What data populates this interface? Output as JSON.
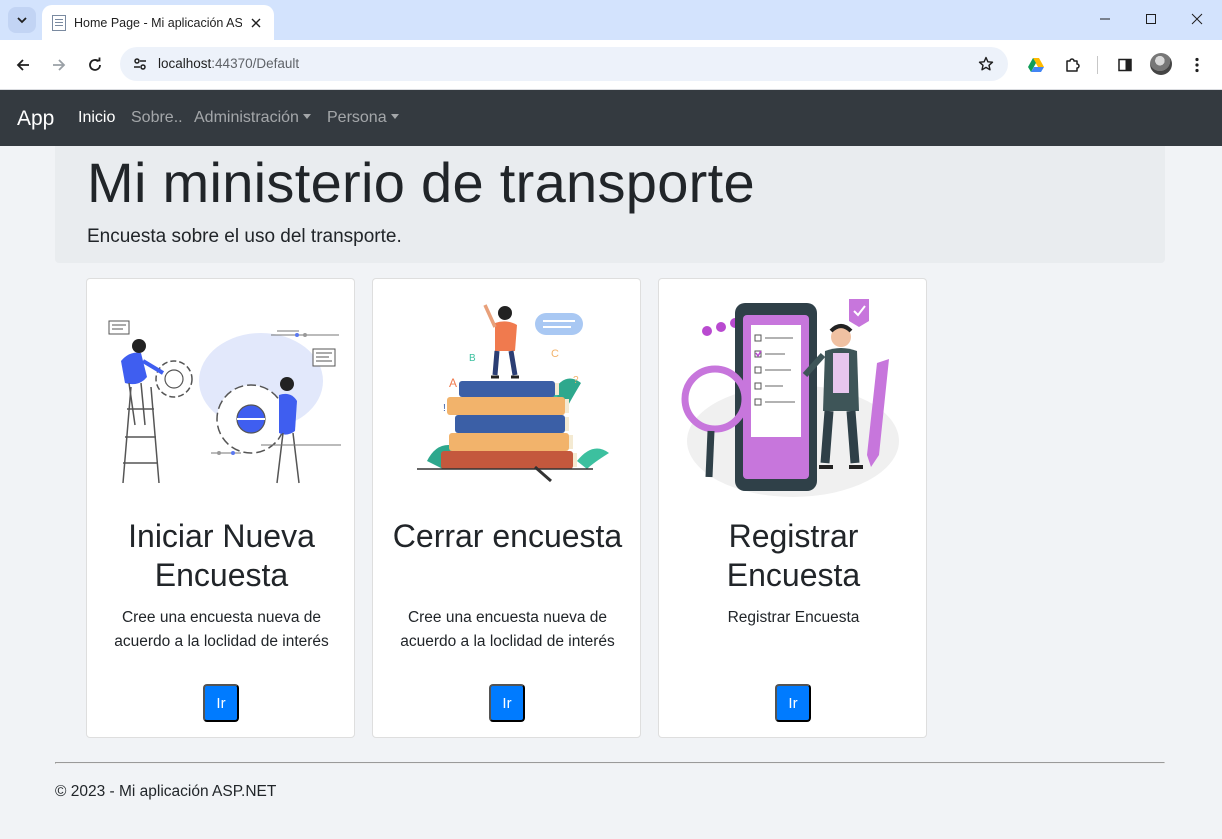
{
  "browser": {
    "tab_title": "Home Page - Mi aplicación ASP.NET",
    "url_host": "localhost",
    "url_rest": ":44370/Default"
  },
  "navbar": {
    "brand": "App",
    "links": [
      {
        "label": "Inicio"
      },
      {
        "label": "Sobre.."
      },
      {
        "label": "Administración"
      },
      {
        "label": "Persona"
      }
    ]
  },
  "jumbotron": {
    "title": "Mi ministerio de transporte",
    "lead": "Encuesta sobre el uso del transporte."
  },
  "cards": [
    {
      "title": "Iniciar Nueva Encuesta",
      "text": "Cree una encuesta nueva de acuerdo a la loclidad de interés",
      "button": "Ir"
    },
    {
      "title": "Cerrar encuesta",
      "text": "Cree una encuesta nueva de acuerdo a la loclidad de interés",
      "button": "Ir"
    },
    {
      "title": "Registrar Encuesta",
      "text": "Registrar Encuesta",
      "button": "Ir"
    }
  ],
  "footer": {
    "text": "© 2023 - Mi aplicación ASP.NET"
  },
  "colors": {
    "navbar": "#343a40",
    "primary": "#007bff",
    "jumbotron": "#e9ecef"
  }
}
